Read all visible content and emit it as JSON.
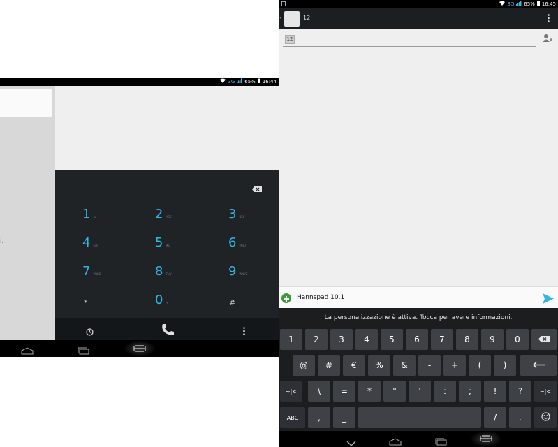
{
  "left": {
    "statusbar": {
      "network": "3G",
      "battery": "65%",
      "time": "16:44"
    },
    "fragment_text": "i.",
    "dialpad": {
      "keys": [
        {
          "digit": "1",
          "letters": "oo"
        },
        {
          "digit": "2",
          "letters": "ABC"
        },
        {
          "digit": "3",
          "letters": "DEF"
        },
        {
          "digit": "4",
          "letters": "GHI"
        },
        {
          "digit": "5",
          "letters": "JKL"
        },
        {
          "digit": "6",
          "letters": "MNO"
        },
        {
          "digit": "7",
          "letters": "PQRS"
        },
        {
          "digit": "8",
          "letters": "TUV"
        },
        {
          "digit": "9",
          "letters": "WXYZ"
        },
        {
          "digit": "*",
          "letters": ""
        },
        {
          "digit": "0",
          "letters": "+"
        },
        {
          "digit": "#",
          "letters": ""
        }
      ]
    }
  },
  "right": {
    "statusbar": {
      "network": "3G",
      "battery": "65%",
      "time": "16:45"
    },
    "appbar": {
      "title": "12"
    },
    "recipient": {
      "chip": "12"
    },
    "compose": {
      "text": "Hannspad 10.1"
    },
    "keyboard": {
      "hint": "La personalizzazione è attiva. Tocca per avere informazioni.",
      "row1": [
        "1",
        "2",
        "3",
        "4",
        "5",
        "6",
        "7",
        "8",
        "9",
        "0"
      ],
      "row2": [
        "@",
        "#",
        "€",
        "%",
        "&",
        "-",
        "+",
        "(",
        ")"
      ],
      "row3": [
        "~|<",
        "\\",
        "=",
        "*",
        "\"",
        "'",
        ":",
        ";",
        "!",
        "?",
        "~|<"
      ],
      "row4": {
        "abc": "ABC",
        "comma": ",",
        "underscore": "_",
        "slash": "/",
        "dot": "."
      }
    }
  },
  "colors": {
    "accent": "#33b5e5",
    "dialpad_bg": "#1f2326",
    "key_bg": "#3e4246"
  }
}
